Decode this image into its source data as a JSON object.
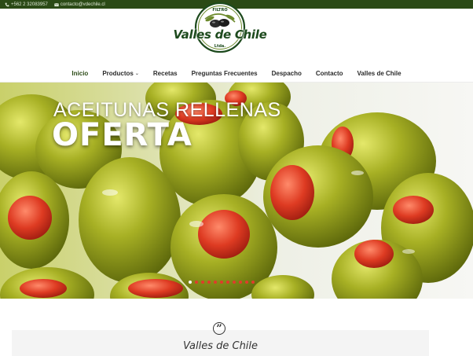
{
  "topbar": {
    "phone": "+562 2 32083957",
    "email": "contacto@vdechile.cl"
  },
  "logo": {
    "brand": "Valles de Chile",
    "badge_top": "FILTRO",
    "badge_bottom": "Ltda."
  },
  "nav": {
    "items": [
      {
        "label": "Inicio"
      },
      {
        "label": "Productos"
      },
      {
        "label": "Recetas"
      },
      {
        "label": "Preguntas Frecuentes"
      },
      {
        "label": "Despacho"
      },
      {
        "label": "Contacto"
      },
      {
        "label": "Valles de Chile"
      }
    ],
    "dropdown_icon": "chevron-down-icon"
  },
  "hero": {
    "subtitle": "ACEITUNAS RELLENAS",
    "title": "OFERTA",
    "slide_count": 11,
    "active_slide": 1
  },
  "testimonial": {
    "icon": "quote-icon",
    "quote_glyph": "”",
    "name": "Valles de Chile"
  },
  "colors": {
    "topbar": "#2b4a16",
    "brand_green": "#1d4a1d",
    "slider_dot": "#e23b2b",
    "olive": "#9aa51c",
    "pimiento": "#d83a24"
  }
}
